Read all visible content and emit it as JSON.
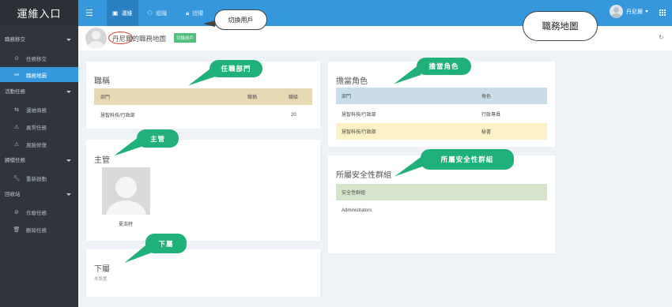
{
  "brand": "運維入口",
  "sidebar": {
    "groups": [
      {
        "label": "職務移交",
        "items": [
          {
            "label": "任務移交",
            "icon": "target-icon"
          },
          {
            "label": "職務地圖",
            "icon": "sitemap-icon",
            "active": true
          }
        ]
      },
      {
        "label": "活動任務",
        "items": [
          {
            "label": "運維商務",
            "icon": "shuffle-icon"
          },
          {
            "label": "異常任務",
            "icon": "warning-icon"
          },
          {
            "label": "風險修復",
            "icon": "warning-icon"
          }
        ]
      },
      {
        "label": "歸檔任務",
        "items": [
          {
            "label": "重新啟動",
            "icon": "wrench-icon"
          }
        ]
      },
      {
        "label": "回收站",
        "items": [
          {
            "label": "作廢任務",
            "icon": "ban-icon"
          },
          {
            "label": "刪除任務",
            "icon": "trash-icon"
          }
        ]
      }
    ]
  },
  "topbar": {
    "tabs": [
      {
        "label": "運維",
        "icon": "dashboard-icon",
        "active": true
      },
      {
        "label": "組織",
        "icon": "users-icon"
      },
      {
        "label": "授權",
        "icon": "lock-icon"
      }
    ],
    "user_name": "丹尼爾"
  },
  "page": {
    "title": "丹尼爾的職務地圖",
    "switch_button": "切換用戶"
  },
  "position_panel": {
    "title": "職稱",
    "headers": [
      "部門",
      "職稱",
      "職級"
    ],
    "rows": [
      [
        "慧智科技/行政部",
        "",
        "20"
      ]
    ],
    "header_color": "#e8d9b5"
  },
  "role_panel": {
    "title": "擔當角色",
    "headers": [
      "部門",
      "角色"
    ],
    "rows": [
      [
        "慧智科技/行政部",
        "行政專員"
      ],
      [
        "慧智科技/行政部",
        "秘書"
      ]
    ],
    "header_color": "#c9dcea",
    "highlight_color": "#fcf1c6"
  },
  "supervisor_panel": {
    "title": "主管",
    "name": "夏浩特"
  },
  "security_panel": {
    "title": "所屬安全性群組",
    "header": "安全性群組",
    "rows": [
      "Administrators"
    ],
    "header_color": "#d5e4c8"
  },
  "subordinate_panel": {
    "title": "下屬",
    "empty_text": "未設置"
  },
  "annotations": {
    "position_dept": "任職部門",
    "roles": "擔當角色",
    "supervisor": "主管",
    "security": "所屬安全性群組",
    "subordinate": "下屬",
    "switch_user": "切換用戶",
    "map_title": "職務地圖",
    "callout_color": "#20b07a"
  }
}
